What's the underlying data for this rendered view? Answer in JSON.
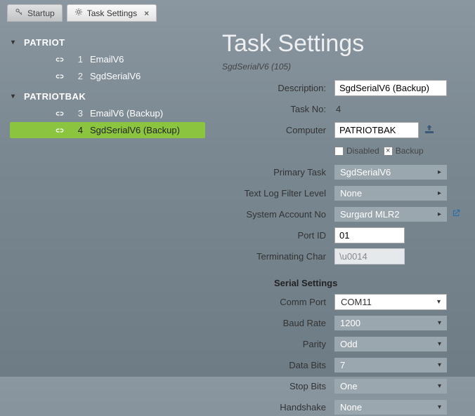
{
  "tabs": {
    "startup": "Startup",
    "task_settings": "Task Settings"
  },
  "tree": {
    "groups": [
      {
        "name": "PATRIOT",
        "items": [
          {
            "num": "1",
            "label": "EmailV6"
          },
          {
            "num": "2",
            "label": "SgdSerialV6"
          }
        ]
      },
      {
        "name": "PATRIOTBAK",
        "items": [
          {
            "num": "3",
            "label": "EmailV6 (Backup)"
          },
          {
            "num": "4",
            "label": "SgdSerialV6 (Backup)"
          }
        ]
      }
    ]
  },
  "panel": {
    "title": "Task Settings",
    "subtitle": "SgdSerialV6 (105)",
    "labels": {
      "description": "Description:",
      "task_no": "Task No:",
      "computer": "Computer",
      "disabled": "Disabled",
      "backup": "Backup",
      "primary_task": "Primary Task",
      "text_log": "Text Log Filter Level",
      "system_account": "System Account No",
      "port_id": "Port ID",
      "term_char": "Terminating Char",
      "serial_settings": "Serial Settings",
      "comm_port": "Comm Port",
      "baud_rate": "Baud Rate",
      "parity": "Parity",
      "data_bits": "Data Bits",
      "stop_bits": "Stop Bits",
      "handshake": "Handshake"
    },
    "values": {
      "description": "SgdSerialV6 (Backup)",
      "task_no": "4",
      "computer": "PATRIOTBAK",
      "disabled_checked": false,
      "backup_checked": true,
      "primary_task": "SgdSerialV6",
      "text_log": "None",
      "system_account": "Surgard MLR2",
      "port_id": "01",
      "term_char": "\\u0014",
      "comm_port": "COM11",
      "baud_rate": "1200",
      "parity": "Odd",
      "data_bits": "7",
      "stop_bits": "One",
      "handshake": "None"
    }
  }
}
